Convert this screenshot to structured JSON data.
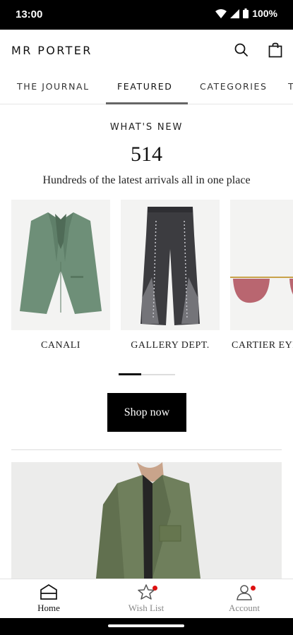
{
  "status_bar": {
    "time": "13:00",
    "battery": "100%",
    "icons": [
      "wifi-icon",
      "signal-icon",
      "battery-icon"
    ]
  },
  "header": {
    "logo": "MR PORTER",
    "icons": [
      "search-icon",
      "shopping-bag-icon"
    ]
  },
  "tabs": {
    "items": [
      {
        "label": "THE JOURNAL"
      },
      {
        "label": "FEATURED",
        "active": true
      },
      {
        "label": "CATEGORIES"
      },
      {
        "label": "T"
      }
    ]
  },
  "whats_new": {
    "eyebrow": "WHAT'S NEW",
    "count": "514",
    "subtitle": "Hundreds of the latest arrivals all in one place",
    "products": [
      {
        "brand": "CANALI",
        "image": "green-blazer"
      },
      {
        "brand": "GALLERY DEPT.",
        "image": "studded-flared-jeans"
      },
      {
        "brand": "CARTIER EYEWEAR",
        "image": "rimless-sunglasses"
      }
    ],
    "carousel_progress": 0.4,
    "cta": "Shop now"
  },
  "bottom_nav": {
    "items": [
      {
        "label": "Home",
        "icon": "home-icon",
        "active": true,
        "badge": false
      },
      {
        "label": "Wish List",
        "icon": "star-icon",
        "active": false,
        "badge": true
      },
      {
        "label": "Account",
        "icon": "account-icon",
        "active": false,
        "badge": true
      }
    ],
    "badge_color": "#DD1111"
  },
  "colors": {
    "accent": "#000000",
    "background": "#FFFFFF",
    "badge": "#DD1111"
  }
}
